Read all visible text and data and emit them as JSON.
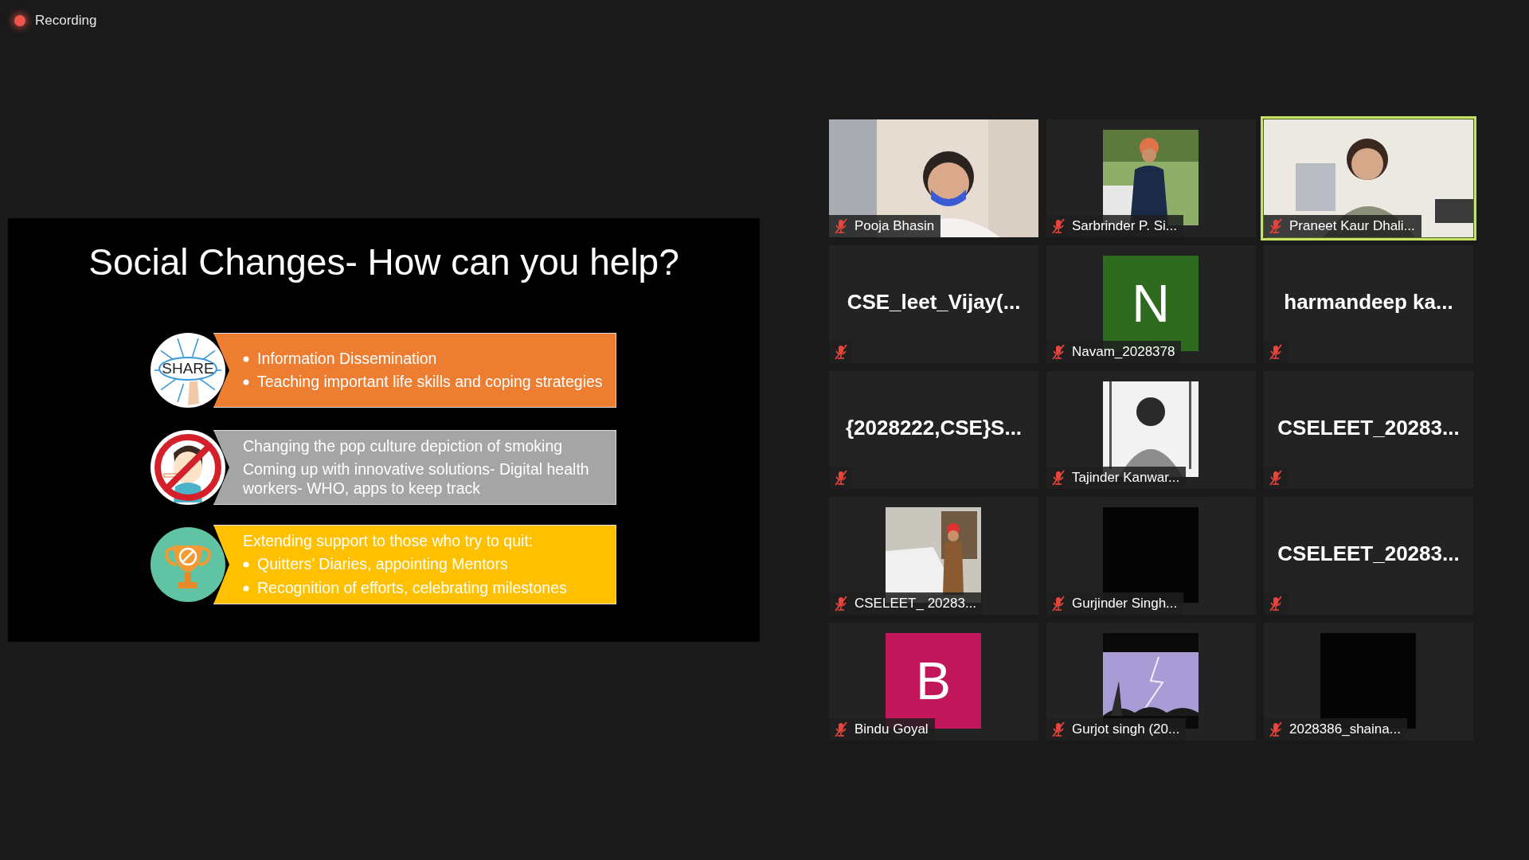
{
  "recording": {
    "label": "Recording",
    "on": true
  },
  "slide": {
    "title": "Social Changes- How can you help?",
    "rows": [
      {
        "kind": "share",
        "icon_text": "SHARE",
        "color": "#ed7d31",
        "lines": [
          {
            "text": "Information Dissemination",
            "bullet": true
          },
          {
            "text": "Teaching important life skills and coping strategies",
            "bullet": true
          }
        ]
      },
      {
        "kind": "no-smoking",
        "color": "#a5a5a5",
        "lines": [
          {
            "text": "Changing the pop culture depiction of smoking",
            "bullet": false
          },
          {
            "text": "Coming up with innovative solutions- Digital health workers- WHO, apps to keep track",
            "bullet": false
          }
        ]
      },
      {
        "kind": "trophy",
        "color": "#ffc000",
        "lines": [
          {
            "text": "Extending support to those who try to quit:",
            "bullet": false
          },
          {
            "text": "Quitters’ Diaries, appointing Mentors",
            "bullet": true
          },
          {
            "text": "Recognition of efforts, celebrating milestones",
            "bullet": true
          }
        ]
      }
    ]
  },
  "participants": [
    {
      "kind": "video",
      "name": "Pooja Bhasin",
      "muted": true,
      "selected": false
    },
    {
      "name": "Sarbrinder P. Si...",
      "muted": true,
      "selected": false
    },
    {
      "kind": "video",
      "name": "Praneet Kaur Dhali...",
      "muted": true,
      "selected": true
    },
    {
      "kind": "name",
      "name": "CSE_leet_Vijay(...",
      "muted": true,
      "selected": false
    },
    {
      "kind": "letter",
      "letter": "N",
      "color": "#2e6b1f",
      "name": "Navam_2028378",
      "muted": true,
      "selected": false
    },
    {
      "kind": "name",
      "name": "harmandeep  ka...",
      "muted": true,
      "selected": false
    },
    {
      "kind": "name",
      "name": "{2028222,CSE}S...",
      "muted": true,
      "selected": false
    },
    {
      "name": "Tajinder Kanwar...",
      "muted": true,
      "selected": false
    },
    {
      "kind": "name",
      "name": "CSELEET_20283...",
      "muted": true,
      "selected": false
    },
    {
      "name": "CSELEET_ 20283...",
      "muted": true,
      "selected": false
    },
    {
      "kind": "blank",
      "name": "Gurjinder Singh...",
      "muted": true,
      "selected": false
    },
    {
      "kind": "name",
      "name": "CSELEET_20283...",
      "muted": true,
      "selected": false
    },
    {
      "kind": "letter",
      "letter": "B",
      "color": "#c2185b",
      "name": "Bindu Goyal",
      "muted": true,
      "selected": false
    },
    {
      "name": "Gurjot singh (20...",
      "muted": true,
      "selected": false
    },
    {
      "kind": "blank",
      "name": "2028386_shaina...",
      "muted": true,
      "selected": false
    }
  ]
}
